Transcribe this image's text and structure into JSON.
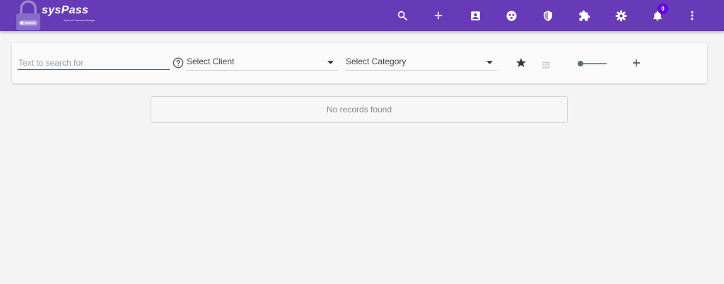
{
  "app": {
    "name": "sysPass",
    "tagline": "Systems Password Manager"
  },
  "header": {
    "icons": [
      {
        "name": "search-icon"
      },
      {
        "name": "add-icon"
      },
      {
        "name": "account-box-icon"
      },
      {
        "name": "face-icon"
      },
      {
        "name": "security-shield-icon"
      },
      {
        "name": "extension-icon"
      },
      {
        "name": "settings-gear-icon"
      },
      {
        "name": "notifications-bell-icon"
      },
      {
        "name": "more-vert-icon"
      }
    ],
    "notification_count": "0"
  },
  "search": {
    "placeholder": "Text to search for",
    "value": "",
    "client_select": "Select Client",
    "category_select": "Select Category"
  },
  "toolbar": {
    "favorites_icon": "star-icon",
    "view_mode_icon": "list-icon",
    "add_icon": "add-icon"
  },
  "results": {
    "empty_message": "No records found"
  },
  "colors": {
    "primary": "#673ab7",
    "badge": "#6200ea",
    "background": "#f4f4f4"
  }
}
